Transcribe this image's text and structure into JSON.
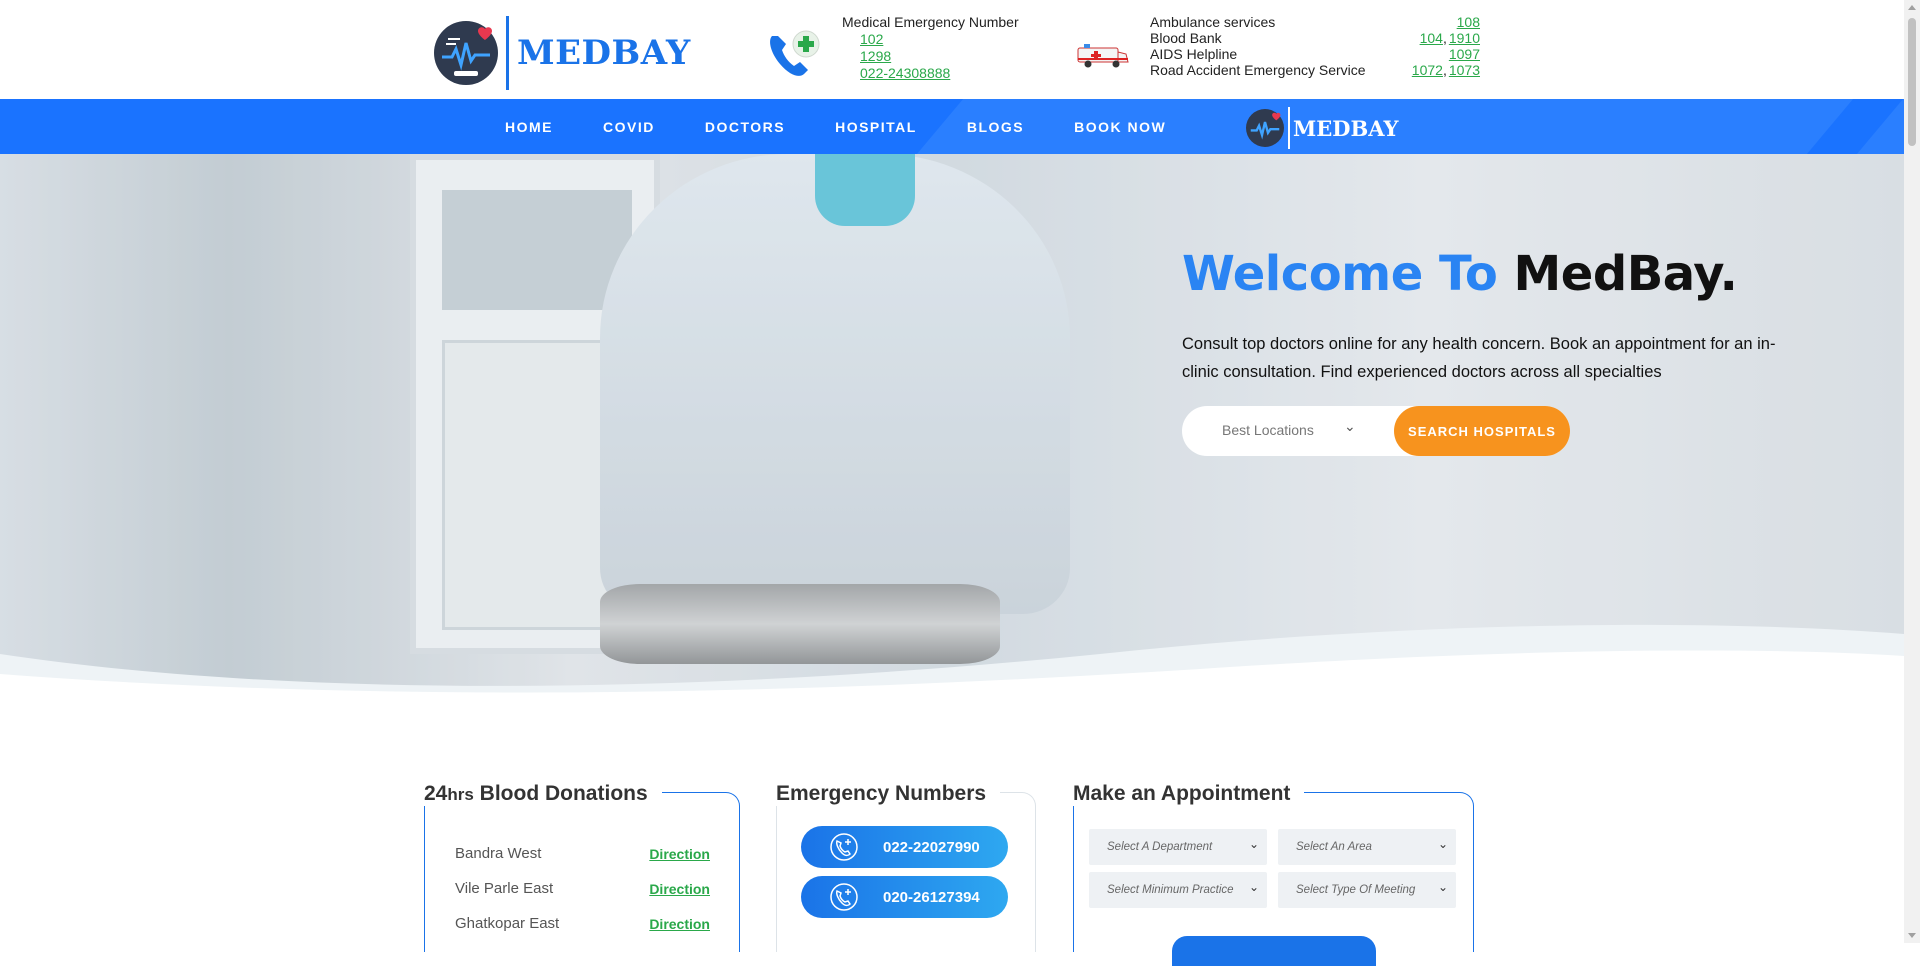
{
  "brand": {
    "name": "MEDBAY"
  },
  "header": {
    "medical_emergency_label": "Medical Emergency Number",
    "medical_emergency_numbers": [
      "102",
      "1298",
      "022-24308888"
    ],
    "services": [
      {
        "label": "Ambulance services",
        "numbers": [
          "108"
        ]
      },
      {
        "label": "Blood Bank",
        "numbers": [
          "104",
          "1910"
        ]
      },
      {
        "label": "AIDS Helpline",
        "numbers": [
          "1097"
        ]
      },
      {
        "label": "Road Accident Emergency Service",
        "numbers": [
          "1072",
          "1073"
        ]
      }
    ]
  },
  "nav": {
    "items": [
      "HOME",
      "COVID",
      "DOCTORS",
      "HOSPITAL",
      "BLOGS",
      "BOOK NOW"
    ],
    "logo_text": "MEDBAY"
  },
  "hero": {
    "title_blue": "Welcome To",
    "title_dark": "MedBay.",
    "lead": "Consult top doctors online for any health concern. Book an appointment for an in-clinic consultation. Find experienced doctors across all specialties",
    "location_select": "Best Locations",
    "search_button": "SEARCH HOSPITALS"
  },
  "blood": {
    "title_prefix": "24",
    "title_small": "hrs",
    "title_rest": "Blood Donations",
    "rows": [
      {
        "place": "Bandra West",
        "link": "Direction"
      },
      {
        "place": "Vile Parle East",
        "link": "Direction"
      },
      {
        "place": "Ghatkopar East",
        "link": "Direction"
      }
    ]
  },
  "emergency": {
    "title": "Emergency Numbers",
    "numbers": [
      "022-22027990",
      "020-26127394"
    ]
  },
  "appointment": {
    "title": "Make an Appointment",
    "selects": [
      "Select A Department",
      "Select An Area",
      "Select Minimum Practice",
      "Select Type Of Meeting"
    ]
  },
  "colors": {
    "primary": "#1a73ff",
    "accent": "#f7931e",
    "link": "#2aa84a",
    "title_blue": "#2a84f3"
  }
}
